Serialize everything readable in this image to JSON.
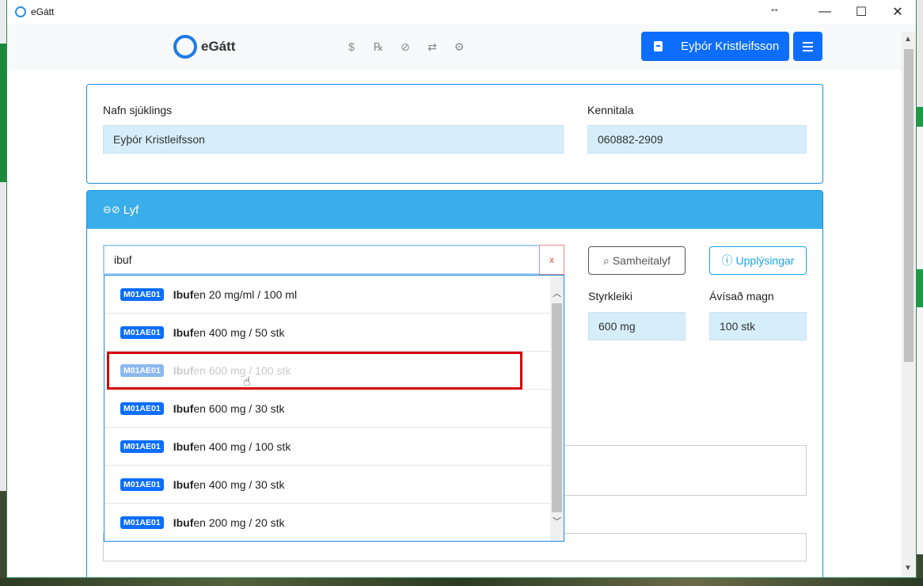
{
  "window": {
    "title": "eGátt",
    "resize_glyph": "↔",
    "minimize": "—",
    "maximize": "☐",
    "close": "✕"
  },
  "appbar": {
    "logo_text": "eGátt",
    "nav_icons": [
      "dollar-icon",
      "prescription-icon",
      "pills-icon",
      "transfer-icon",
      "settings-icon"
    ],
    "nav_glyphs": [
      "$",
      "℞",
      "⊘",
      "⇄",
      "⚙"
    ],
    "user_name": "Eyþór Kristleifsson",
    "accent": "#0d6efd"
  },
  "patient": {
    "name_label": "Nafn sjúklings",
    "name_value": "Eyþór Kristleifsson",
    "ssn_label": "Kennitala",
    "ssn_value": "060882-2909"
  },
  "lyf": {
    "header": "Lyf",
    "header_glyph": "⊖⊘",
    "search_value": "ibuf",
    "clear_label": "x",
    "samheitalyf_label": "Samheitalyf",
    "samheitalyf_glyph": "⌕",
    "upplysingar_label": "Upplýsingar",
    "upplysingar_glyph": "ⓘ",
    "styrkleiki_label": "Styrkleiki",
    "styrkleiki_value": "600 mg",
    "magn_label": "Ávísað magn",
    "magn_value": "100 stk",
    "header_color": "#3aaeea"
  },
  "dropdown": {
    "items": [
      {
        "code": "M01AE01",
        "match": "Ibuf",
        "rest": "en 20 mg/ml / 100 ml"
      },
      {
        "code": "M01AE01",
        "match": "Ibuf",
        "rest": "en 400 mg / 50 stk"
      },
      {
        "code": "M01AE01",
        "match": "Ibuf",
        "rest": "en 600 mg / 100 stk"
      },
      {
        "code": "M01AE01",
        "match": "Ibuf",
        "rest": "en 600 mg / 30 stk"
      },
      {
        "code": "M01AE01",
        "match": "Ibuf",
        "rest": "en 400 mg / 100 stk"
      },
      {
        "code": "M01AE01",
        "match": "Ibuf",
        "rest": "en 400 mg / 30 stk"
      },
      {
        "code": "M01AE01",
        "match": "Ibuf",
        "rest": "en 200 mg / 20 stk"
      }
    ],
    "highlight_color": "#d50000"
  }
}
